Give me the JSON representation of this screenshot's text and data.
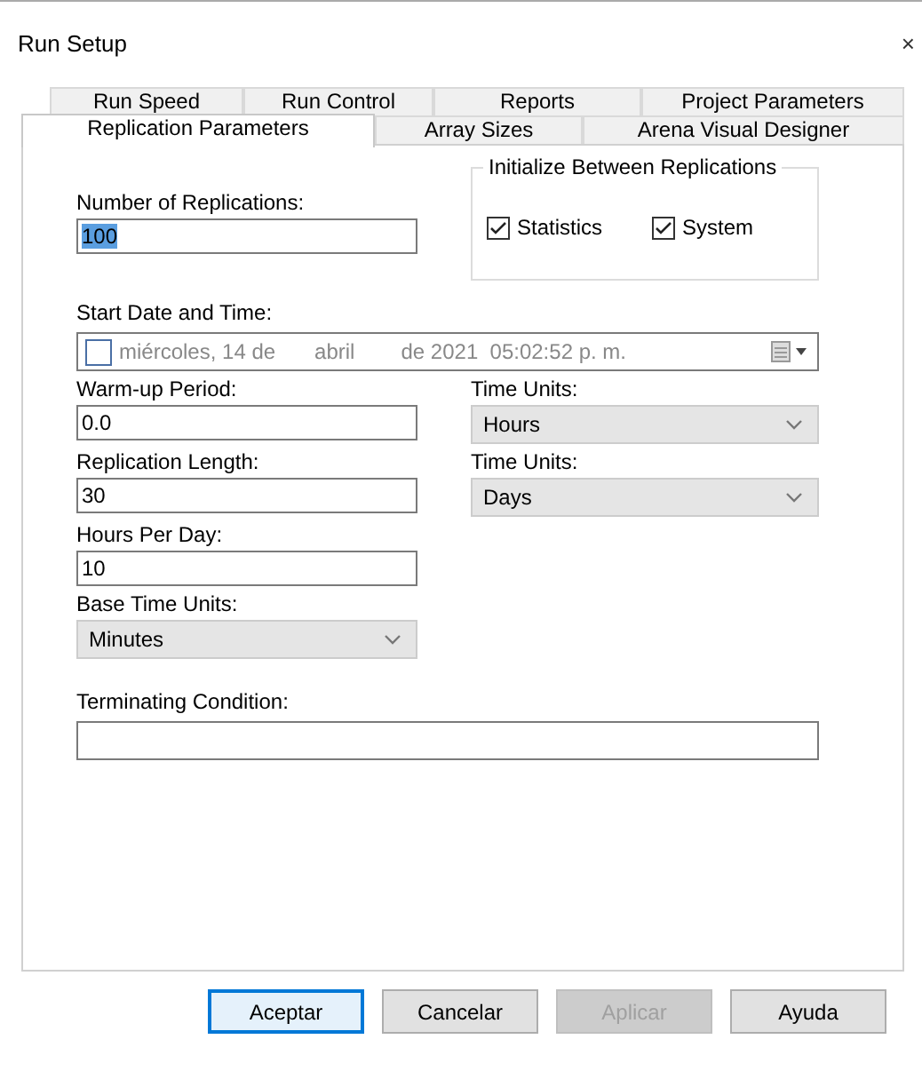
{
  "window": {
    "title": "Run Setup",
    "close": "×"
  },
  "tab_rows": [
    [
      {
        "label": "Run Speed",
        "selected": false
      },
      {
        "label": "Run Control",
        "selected": false
      },
      {
        "label": "Reports",
        "selected": false
      },
      {
        "label": "Project Parameters",
        "selected": false
      }
    ],
    [
      {
        "label": "Replication Parameters",
        "selected": true
      },
      {
        "label": "Array Sizes",
        "selected": false
      },
      {
        "label": "Arena Visual Designer",
        "selected": false
      }
    ]
  ],
  "rows": [
    [
      {
        "kind": "text",
        "label": "Number of Replications:",
        "value": "100",
        "highlighted": true
      },
      {
        "kind": "group",
        "title": "Initialize Between Replications",
        "options": [
          {
            "label": "Statistics",
            "checked": true
          },
          {
            "label": "System",
            "checked": true
          }
        ]
      }
    ],
    [
      {
        "kind": "date",
        "label": "Start Date and Time:",
        "checked": false,
        "parts": [
          "miércoles, 14 de",
          "abril",
          "de 2021  05:02:52 p. m."
        ]
      }
    ],
    [
      {
        "kind": "text",
        "label": "Warm-up Period:",
        "value": "0.0",
        "highlighted": false
      },
      {
        "kind": "combo",
        "label": "Time Units:",
        "value": "Hours"
      }
    ],
    [
      {
        "kind": "text",
        "label": "Replication Length:",
        "value": "30",
        "highlighted": false
      },
      {
        "kind": "combo",
        "label": "Time Units:",
        "value": "Days"
      }
    ],
    [
      {
        "kind": "text",
        "label": "Hours Per Day:",
        "value": "10",
        "highlighted": false
      }
    ],
    [
      {
        "kind": "combo",
        "label": "Base Time Units:",
        "value": "Minutes"
      }
    ],
    [
      {
        "kind": "wide",
        "label": "Terminating Condition:"
      }
    ]
  ],
  "buttons": [
    {
      "label": "Aceptar",
      "default": true,
      "disabled": false
    },
    {
      "label": "Cancelar",
      "default": false,
      "disabled": false
    },
    {
      "label": "Aplicar",
      "default": false,
      "disabled": true
    },
    {
      "label": "Ayuda",
      "default": false,
      "disabled": false
    }
  ]
}
